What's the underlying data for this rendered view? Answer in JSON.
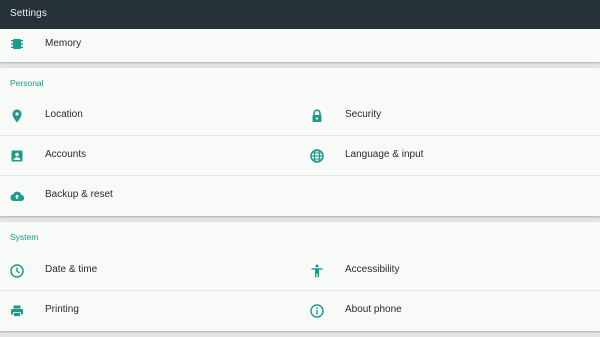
{
  "appbar": {
    "title": "Settings"
  },
  "colors": {
    "appbar": "#263238",
    "accent": "#1d9a8a",
    "icon": "#1d9a8a",
    "card": "#f7faf7"
  },
  "memory": {
    "label": "Memory",
    "icon": "memory-icon"
  },
  "personal": {
    "header": "Personal",
    "items": [
      {
        "label": "Location",
        "icon": "location-icon"
      },
      {
        "label": "Security",
        "icon": "lock-icon"
      },
      {
        "label": "Accounts",
        "icon": "account-box-icon"
      },
      {
        "label": "Language & input",
        "icon": "globe-icon"
      },
      {
        "label": "Backup & reset",
        "icon": "cloud-upload-icon"
      }
    ]
  },
  "system": {
    "header": "System",
    "items": [
      {
        "label": "Date & time",
        "icon": "clock-icon"
      },
      {
        "label": "Accessibility",
        "icon": "accessibility-icon"
      },
      {
        "label": "Printing",
        "icon": "printer-icon"
      },
      {
        "label": "About phone",
        "icon": "info-icon"
      }
    ]
  }
}
